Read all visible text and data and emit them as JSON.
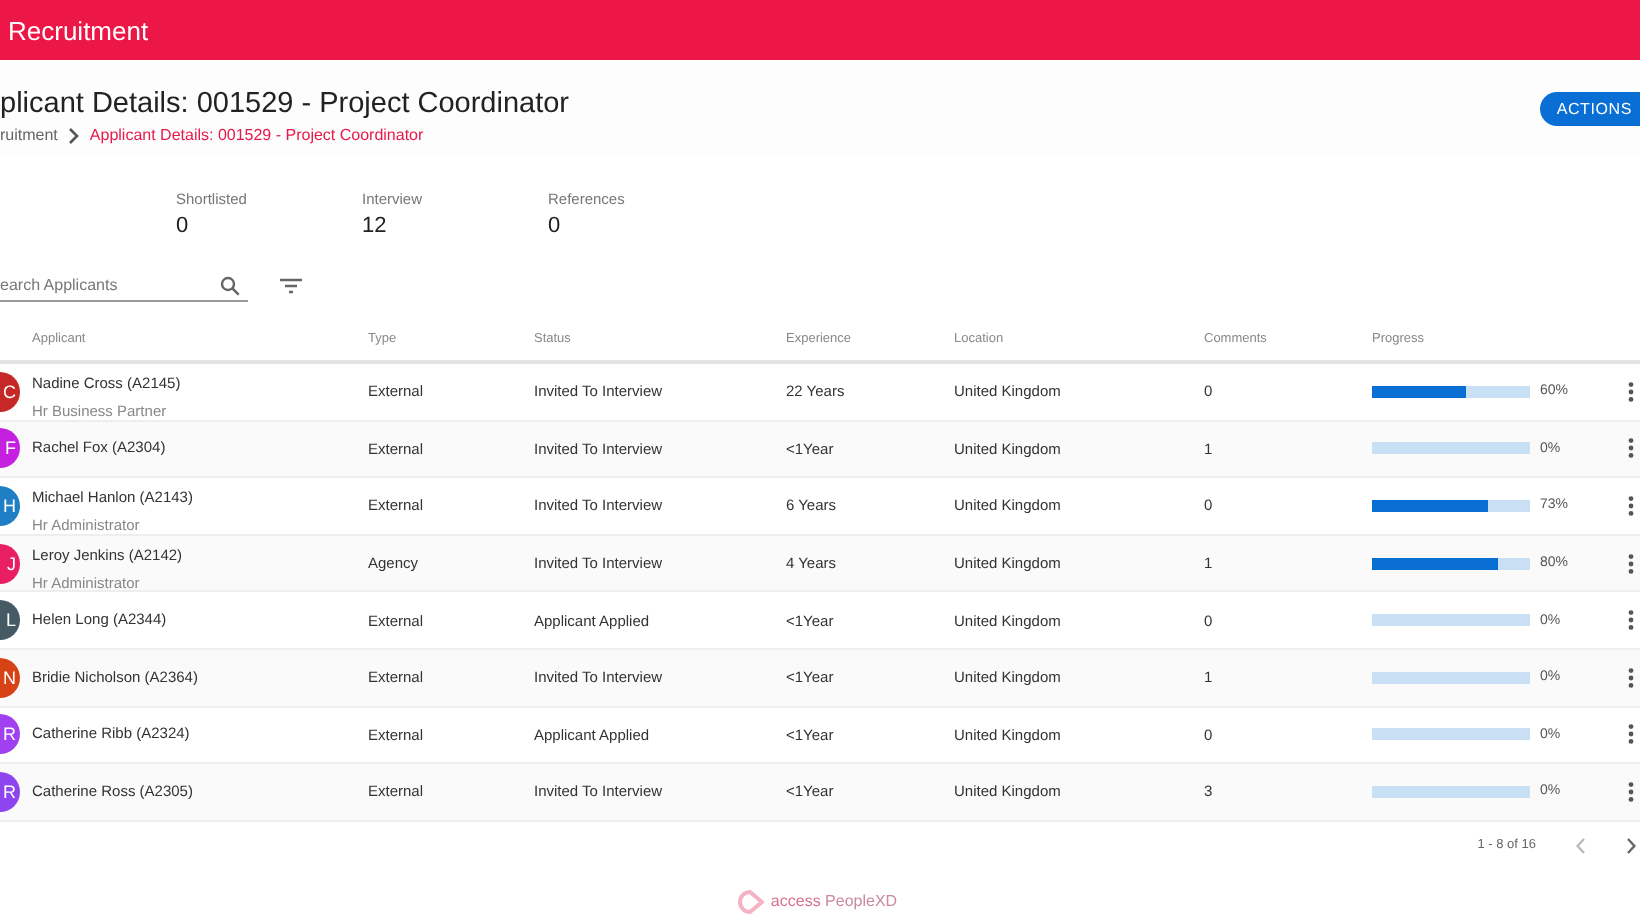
{
  "app_bar": {
    "title": "Recruitment"
  },
  "header": {
    "title": "plicant Details: 001529 - Project Coordinator",
    "breadcrumb": [
      {
        "label": "ruitment",
        "selected": false
      },
      {
        "label": "Applicant Details: 001529 - Project Coordinator",
        "selected": true
      }
    ],
    "actions_button": "ACTIONS"
  },
  "stats": [
    {
      "label": "Shortlisted",
      "value": "0"
    },
    {
      "label": "Interview",
      "value": "12"
    },
    {
      "label": "References",
      "value": "0"
    }
  ],
  "search": {
    "placeholder": "earch Applicants"
  },
  "table": {
    "columns": [
      "Applicant",
      "Type",
      "Status",
      "Experience",
      "Location",
      "Comments",
      "Progress"
    ],
    "rows": [
      {
        "initials": "C",
        "color": "#c62828",
        "name": "Nadine Cross (A2145)",
        "role": "Hr Business Partner",
        "type": "External",
        "status": "Invited To Interview",
        "experience": "22 Years",
        "location": "United Kingdom",
        "comments": "0",
        "level": 0.6,
        "percent": "60%"
      },
      {
        "initials": "F",
        "color": "#c51fe0",
        "name": "Rachel Fox (A2304)",
        "role": "",
        "type": "External",
        "status": "Invited To Interview",
        "experience": "<1Year",
        "location": "United Kingdom",
        "comments": "1",
        "level": 0,
        "percent": "0%"
      },
      {
        "initials": "H",
        "color": "#1e7fc4",
        "name": "Michael Hanlon (A2143)",
        "role": "Hr Administrator",
        "type": "External",
        "status": "Invited To Interview",
        "experience": "6 Years",
        "location": "United Kingdom",
        "comments": "0",
        "level": 0.73,
        "percent": "73%"
      },
      {
        "initials": "J",
        "color": "#e91e63",
        "name": "Leroy Jenkins (A2142)",
        "role": "Hr Administrator",
        "type": "Agency",
        "status": "Invited To Interview",
        "experience": "4 Years",
        "location": "United Kingdom",
        "comments": "1",
        "level": 0.8,
        "percent": "80%"
      },
      {
        "initials": "L",
        "color": "#455a64",
        "name": "Helen Long (A2344)",
        "role": "",
        "type": "External",
        "status": "Applicant Applied",
        "experience": "<1Year",
        "location": "United Kingdom",
        "comments": "0",
        "level": 0,
        "percent": "0%"
      },
      {
        "initials": "N",
        "color": "#d84315",
        "name": "Bridie Nicholson (A2364)",
        "role": "",
        "type": "External",
        "status": "Invited To Interview",
        "experience": "<1Year",
        "location": "United Kingdom",
        "comments": "1",
        "level": 0,
        "percent": "0%"
      },
      {
        "initials": "R",
        "color": "#a040f0",
        "name": "Catherine Ribb (A2324)",
        "role": "",
        "type": "External",
        "status": "Applicant Applied",
        "experience": "<1Year",
        "location": "United Kingdom",
        "comments": "0",
        "level": 0,
        "percent": "0%"
      },
      {
        "initials": "R",
        "color": "#8e44ef",
        "name": "Catherine Ross (A2305)",
        "role": "",
        "type": "External",
        "status": "Invited To Interview",
        "experience": "<1Year",
        "location": "United Kingdom",
        "comments": "3",
        "level": 0,
        "percent": "0%"
      }
    ]
  },
  "pagination": {
    "range": "1 - 8 of 16"
  },
  "footer": {
    "logo_bold": "access",
    "logo_light": "PeopleXD"
  }
}
